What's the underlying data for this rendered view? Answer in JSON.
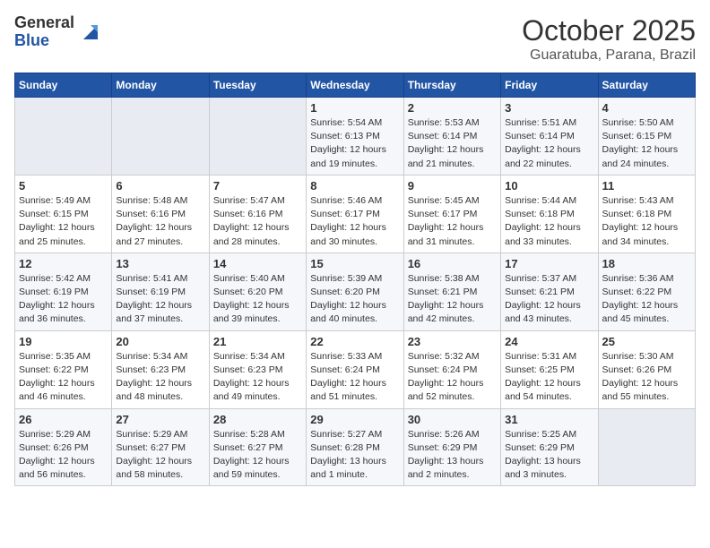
{
  "header": {
    "logo_general": "General",
    "logo_blue": "Blue",
    "title": "October 2025",
    "subtitle": "Guaratuba, Parana, Brazil"
  },
  "weekdays": [
    "Sunday",
    "Monday",
    "Tuesday",
    "Wednesday",
    "Thursday",
    "Friday",
    "Saturday"
  ],
  "weeks": [
    [
      {
        "day": "",
        "info": ""
      },
      {
        "day": "",
        "info": ""
      },
      {
        "day": "",
        "info": ""
      },
      {
        "day": "1",
        "info": "Sunrise: 5:54 AM\nSunset: 6:13 PM\nDaylight: 12 hours and 19 minutes."
      },
      {
        "day": "2",
        "info": "Sunrise: 5:53 AM\nSunset: 6:14 PM\nDaylight: 12 hours and 21 minutes."
      },
      {
        "day": "3",
        "info": "Sunrise: 5:51 AM\nSunset: 6:14 PM\nDaylight: 12 hours and 22 minutes."
      },
      {
        "day": "4",
        "info": "Sunrise: 5:50 AM\nSunset: 6:15 PM\nDaylight: 12 hours and 24 minutes."
      }
    ],
    [
      {
        "day": "5",
        "info": "Sunrise: 5:49 AM\nSunset: 6:15 PM\nDaylight: 12 hours and 25 minutes."
      },
      {
        "day": "6",
        "info": "Sunrise: 5:48 AM\nSunset: 6:16 PM\nDaylight: 12 hours and 27 minutes."
      },
      {
        "day": "7",
        "info": "Sunrise: 5:47 AM\nSunset: 6:16 PM\nDaylight: 12 hours and 28 minutes."
      },
      {
        "day": "8",
        "info": "Sunrise: 5:46 AM\nSunset: 6:17 PM\nDaylight: 12 hours and 30 minutes."
      },
      {
        "day": "9",
        "info": "Sunrise: 5:45 AM\nSunset: 6:17 PM\nDaylight: 12 hours and 31 minutes."
      },
      {
        "day": "10",
        "info": "Sunrise: 5:44 AM\nSunset: 6:18 PM\nDaylight: 12 hours and 33 minutes."
      },
      {
        "day": "11",
        "info": "Sunrise: 5:43 AM\nSunset: 6:18 PM\nDaylight: 12 hours and 34 minutes."
      }
    ],
    [
      {
        "day": "12",
        "info": "Sunrise: 5:42 AM\nSunset: 6:19 PM\nDaylight: 12 hours and 36 minutes."
      },
      {
        "day": "13",
        "info": "Sunrise: 5:41 AM\nSunset: 6:19 PM\nDaylight: 12 hours and 37 minutes."
      },
      {
        "day": "14",
        "info": "Sunrise: 5:40 AM\nSunset: 6:20 PM\nDaylight: 12 hours and 39 minutes."
      },
      {
        "day": "15",
        "info": "Sunrise: 5:39 AM\nSunset: 6:20 PM\nDaylight: 12 hours and 40 minutes."
      },
      {
        "day": "16",
        "info": "Sunrise: 5:38 AM\nSunset: 6:21 PM\nDaylight: 12 hours and 42 minutes."
      },
      {
        "day": "17",
        "info": "Sunrise: 5:37 AM\nSunset: 6:21 PM\nDaylight: 12 hours and 43 minutes."
      },
      {
        "day": "18",
        "info": "Sunrise: 5:36 AM\nSunset: 6:22 PM\nDaylight: 12 hours and 45 minutes."
      }
    ],
    [
      {
        "day": "19",
        "info": "Sunrise: 5:35 AM\nSunset: 6:22 PM\nDaylight: 12 hours and 46 minutes."
      },
      {
        "day": "20",
        "info": "Sunrise: 5:34 AM\nSunset: 6:23 PM\nDaylight: 12 hours and 48 minutes."
      },
      {
        "day": "21",
        "info": "Sunrise: 5:34 AM\nSunset: 6:23 PM\nDaylight: 12 hours and 49 minutes."
      },
      {
        "day": "22",
        "info": "Sunrise: 5:33 AM\nSunset: 6:24 PM\nDaylight: 12 hours and 51 minutes."
      },
      {
        "day": "23",
        "info": "Sunrise: 5:32 AM\nSunset: 6:24 PM\nDaylight: 12 hours and 52 minutes."
      },
      {
        "day": "24",
        "info": "Sunrise: 5:31 AM\nSunset: 6:25 PM\nDaylight: 12 hours and 54 minutes."
      },
      {
        "day": "25",
        "info": "Sunrise: 5:30 AM\nSunset: 6:26 PM\nDaylight: 12 hours and 55 minutes."
      }
    ],
    [
      {
        "day": "26",
        "info": "Sunrise: 5:29 AM\nSunset: 6:26 PM\nDaylight: 12 hours and 56 minutes."
      },
      {
        "day": "27",
        "info": "Sunrise: 5:29 AM\nSunset: 6:27 PM\nDaylight: 12 hours and 58 minutes."
      },
      {
        "day": "28",
        "info": "Sunrise: 5:28 AM\nSunset: 6:27 PM\nDaylight: 12 hours and 59 minutes."
      },
      {
        "day": "29",
        "info": "Sunrise: 5:27 AM\nSunset: 6:28 PM\nDaylight: 13 hours and 1 minute."
      },
      {
        "day": "30",
        "info": "Sunrise: 5:26 AM\nSunset: 6:29 PM\nDaylight: 13 hours and 2 minutes."
      },
      {
        "day": "31",
        "info": "Sunrise: 5:25 AM\nSunset: 6:29 PM\nDaylight: 13 hours and 3 minutes."
      },
      {
        "day": "",
        "info": ""
      }
    ]
  ]
}
